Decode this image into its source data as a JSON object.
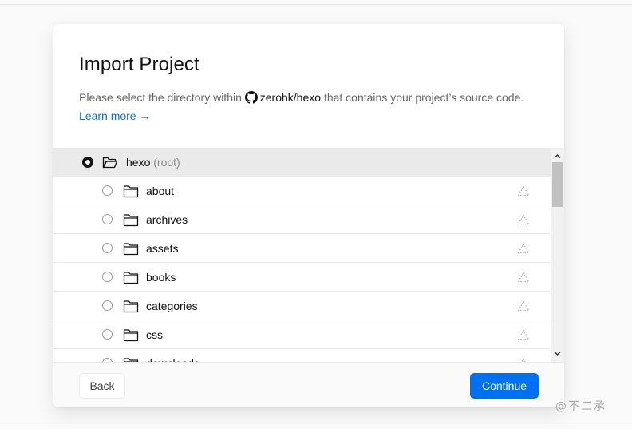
{
  "modal": {
    "title": "Import Project",
    "description_before": "Please select the directory within",
    "repo_name": "zerohk/hexo",
    "description_after": "that contains your project’s source code.",
    "learn_more": "Learn more →"
  },
  "tree": {
    "root": {
      "name": "hexo",
      "suffix": "(root)",
      "selected": true
    },
    "items": [
      {
        "name": "about"
      },
      {
        "name": "archives"
      },
      {
        "name": "assets"
      },
      {
        "name": "books"
      },
      {
        "name": "categories"
      },
      {
        "name": "css"
      },
      {
        "name": "downloads"
      }
    ]
  },
  "footer": {
    "back_label": "Back",
    "continue_label": "Continue"
  },
  "watermark": "@不二承",
  "colors": {
    "accent": "#0070f3",
    "selected_row": "#eaeaea",
    "footer_bg": "#fafafa"
  }
}
